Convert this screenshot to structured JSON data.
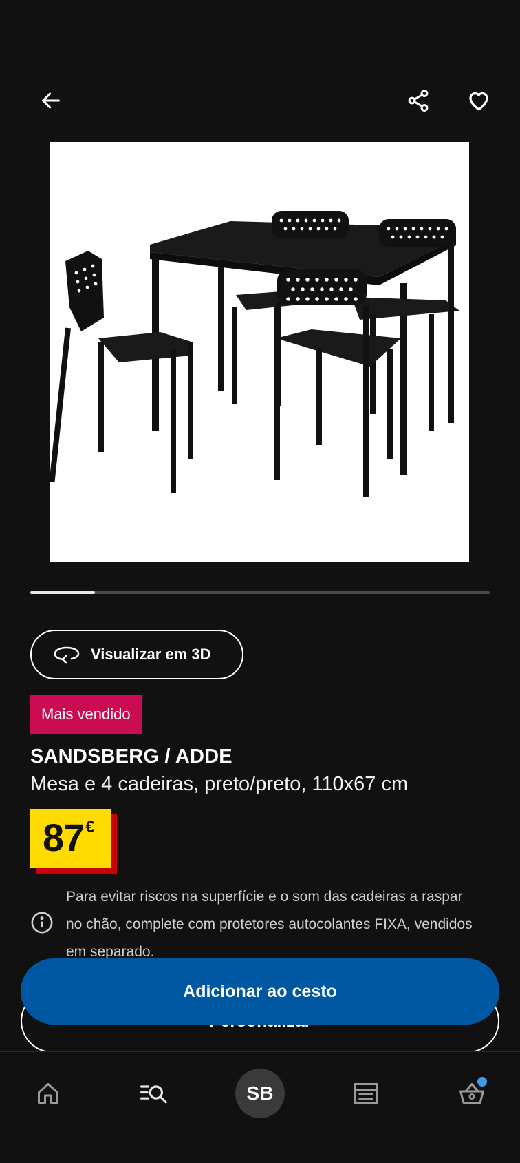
{
  "topbar": {
    "back_icon": "arrow-left-icon",
    "share_icon": "share-icon",
    "favorite_icon": "heart-icon"
  },
  "gallery": {
    "image_alt": "SANDSBERG / ADDE mesa com 4 cadeiras pretas",
    "progress_fraction": 0.14
  },
  "view3d": {
    "label": "Visualizar em 3D",
    "icon": "rotate-3d-icon"
  },
  "badge": {
    "label": "Mais vendido",
    "color": "#cc0c52"
  },
  "product": {
    "name": "SANDSBERG / ADDE",
    "description": "Mesa e 4 cadeiras, preto/preto, 110x67 cm"
  },
  "price": {
    "amount": "87",
    "currency": "€",
    "box_color": "#ffdb00",
    "shadow_color": "#cc0008"
  },
  "info": {
    "icon": "info-icon",
    "text": "Para evitar riscos na superfície e o som das cadeiras a raspar no chão, complete com protetores autocolantes FIXA, vendidos em separado."
  },
  "actions": {
    "add_to_cart_label": "Adicionar ao cesto",
    "add_to_cart_color": "#0058a3",
    "personalize_label": "Personalizar"
  },
  "nav": {
    "home_icon": "home-icon",
    "search_icon": "search-list-icon",
    "avatar_initials": "SB",
    "store_icon": "store-icon",
    "cart_icon": "basket-icon",
    "cart_dot_color": "#3d9be9"
  }
}
